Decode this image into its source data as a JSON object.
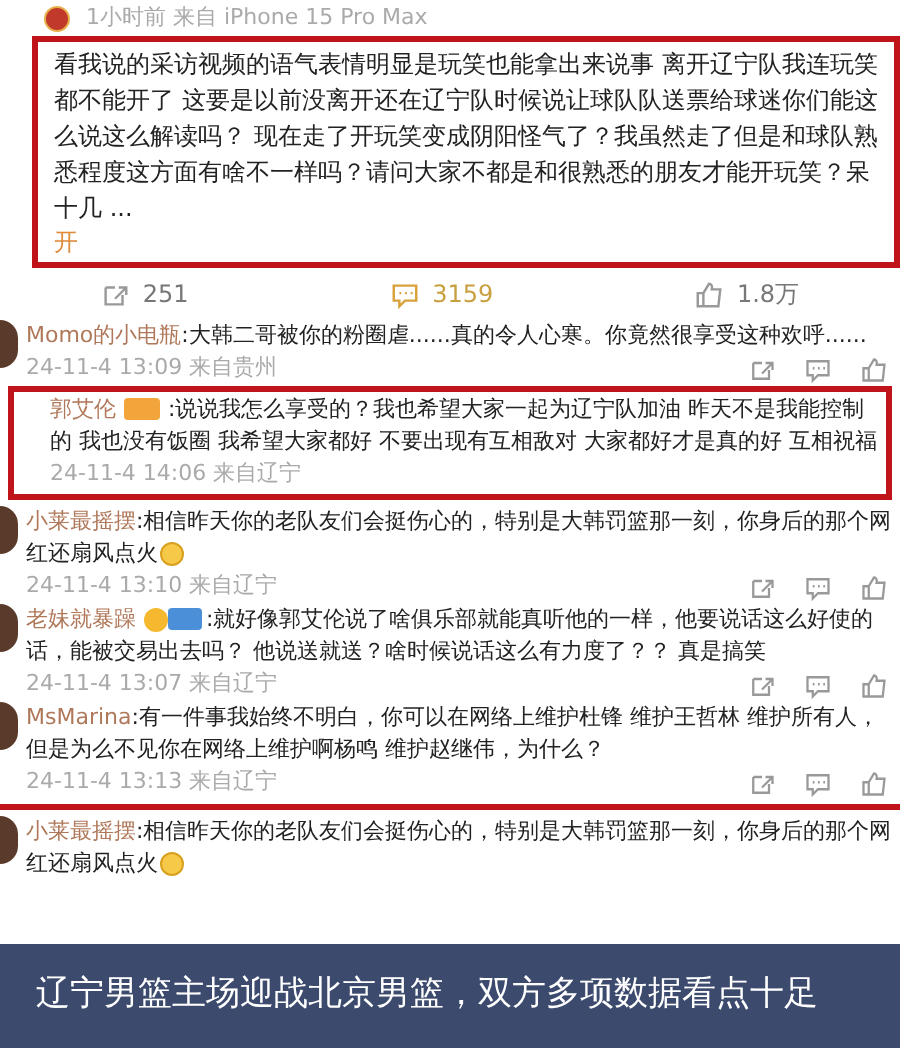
{
  "post": {
    "meta": "1小时前 来自 iPhone 15 Pro Max",
    "text": "看我说的采访视频的语气表情明显是玩笑也能拿出来说事 离开辽宁队我连玩笑都不能开了 这要是以前没离开还在辽宁队时候说让球队队送票给球迷你们能这么说这么解读吗？ 现在走了开玩笑变成阴阳怪气了？我虽然走了但是和球队熟悉程度这方面有啥不一样吗？请问大家不都是和很熟悉的朋友才能开玩笑？呆十几 ...",
    "expand": "开",
    "highlighted": true,
    "shares": "251",
    "comments": "3159",
    "likes": "1.8万"
  },
  "comments": [
    {
      "kind": "comment",
      "user": "Momo的小电瓶",
      "text": ":大韩二哥被你的粉圈虐......真的令人心寒。你竟然很享受这种欢呼......",
      "emoji": false,
      "meta": "24-11-4 13:09 来自贵州",
      "highlighted": false
    },
    {
      "kind": "reply",
      "user": "郭艾伦",
      "badges": [
        {
          "kind": "tag"
        }
      ],
      "text": ":说说我怎么享受的？我也希望大家一起为辽宁队加油 昨天不是我能控制的 我也没有饭圈 我希望大家都好 不要出现有互相敌对 大家都好才是真的好 互相祝福",
      "emoji": false,
      "meta": "24-11-4 14:06 来自辽宁",
      "highlighted": true
    },
    {
      "kind": "comment",
      "user": "小莱最摇摆",
      "text": ":相信昨天你的老队友们会挺伤心的，特别是大韩罚篮那一刻，你身后的那个网红还扇风点火",
      "emoji": true,
      "meta": "24-11-4 13:10 来自辽宁",
      "highlighted": false
    },
    {
      "kind": "comment",
      "user": "老妹就暴躁",
      "badges": [
        {
          "kind": "emoji"
        },
        {
          "kind": "fan"
        }
      ],
      "text": ":就好像郭艾伦说了啥俱乐部就能真听他的一样，他要说话这么好使的话，能被交易出去吗？ 他说送就送？啥时候说话这么有力度了？？ 真是搞笑",
      "emoji": false,
      "meta": "24-11-4 13:07 来自辽宁",
      "highlighted": false
    },
    {
      "kind": "comment",
      "user": "MsMarina",
      "text": ":有一件事我始终不明白，你可以在网络上维护杜锋 维护王哲林 维护所有人，但是为么不见你在网络上维护啊杨鸣 维护赵继伟，为什么？",
      "emoji": false,
      "meta": "24-11-4 13:13 来自辽宁",
      "highlighted": false
    },
    {
      "kind": "comment",
      "user": "小莱最摇摆",
      "text": ":相信昨天你的老队友们会挺伤心的，特别是大韩罚篮那一刻，你身后的那个网红还扇风点火",
      "emoji": true,
      "highlighted": false
    }
  ],
  "caption": "辽宁男篮主场迎战北京男篮，双方多项数据看点十足"
}
